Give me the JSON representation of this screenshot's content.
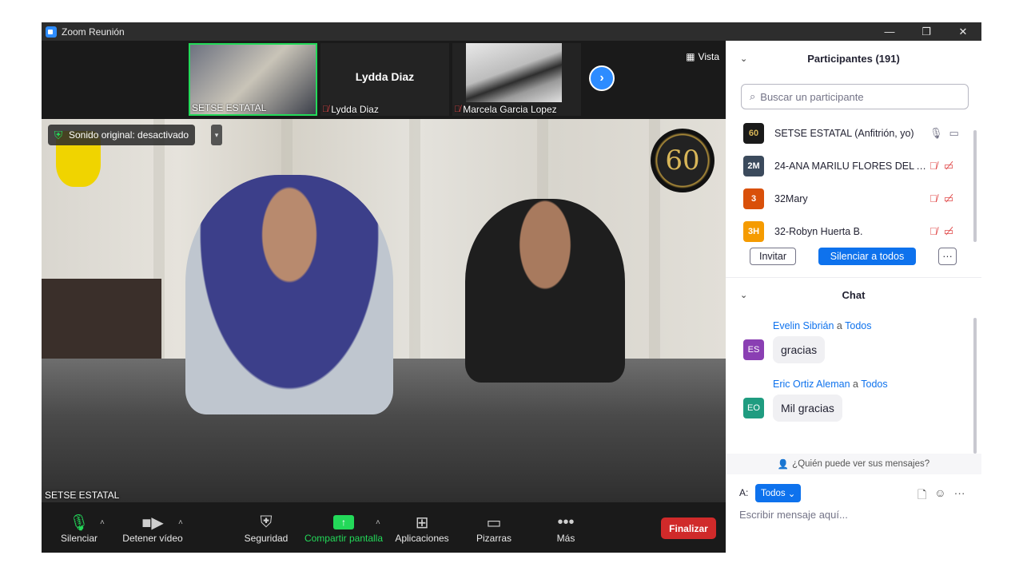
{
  "window": {
    "title": "Zoom Reunión",
    "controls": [
      "—",
      "❐",
      "✕"
    ]
  },
  "strip": {
    "thumbs": [
      {
        "name": "SETSE ESTATAL",
        "muted": false
      },
      {
        "name": "Lydda Diaz",
        "display_name": "Lydda Diaz",
        "muted": true
      },
      {
        "name": "Marcela Garcia Lopez",
        "muted": true
      }
    ],
    "view_label": "Vista"
  },
  "main_video": {
    "sound_label": "Sonido original: desactivado",
    "badge_text": "60",
    "speaker_name": "SETSE ESTATAL"
  },
  "toolbar": {
    "mute_label": "Silenciar",
    "video_label": "Detener vídeo",
    "security_label": "Seguridad",
    "share_label": "Compartir pantalla",
    "apps_label": "Aplicaciones",
    "whiteboards_label": "Pizarras",
    "more_label": "Más",
    "end_label": "Finalizar"
  },
  "participants": {
    "header": "Participantes (191)",
    "search_placeholder": "Buscar un participante",
    "list": [
      {
        "initials": "60",
        "name": "SETSE ESTATAL (Anfitrión, yo)",
        "color": "#1a1a1a",
        "muted": false
      },
      {
        "initials": "2M",
        "name": "24-ANA MARILU FLORES DEL A...",
        "color": "#3b4a5c",
        "muted": true
      },
      {
        "initials": "3",
        "name": "32Mary",
        "color": "#d9500a",
        "muted": true
      },
      {
        "initials": "3H",
        "name": "32-Robyn Huerta B.",
        "color": "#f59b00",
        "muted": true
      }
    ],
    "invite_label": "Invitar",
    "mute_all_label": "Silenciar a todos",
    "more_label": "···"
  },
  "chat": {
    "header": "Chat",
    "messages": [
      {
        "initials": "ES",
        "color": "#8a3fb3",
        "sender": "Evelin Sibrián",
        "to_word": "a",
        "recipient": "Todos",
        "text": "gracias"
      },
      {
        "initials": "EO",
        "color": "#1f9c80",
        "sender": "Eric Ortiz Aleman",
        "to_word": "a",
        "recipient": "Todos",
        "text": "Mil gracias"
      }
    ],
    "who_can_see": "¿Quién puede ver sus mensajes?",
    "to_label": "A:",
    "to_value": "Todos",
    "input_placeholder": "Escribir mensaje aquí..."
  }
}
